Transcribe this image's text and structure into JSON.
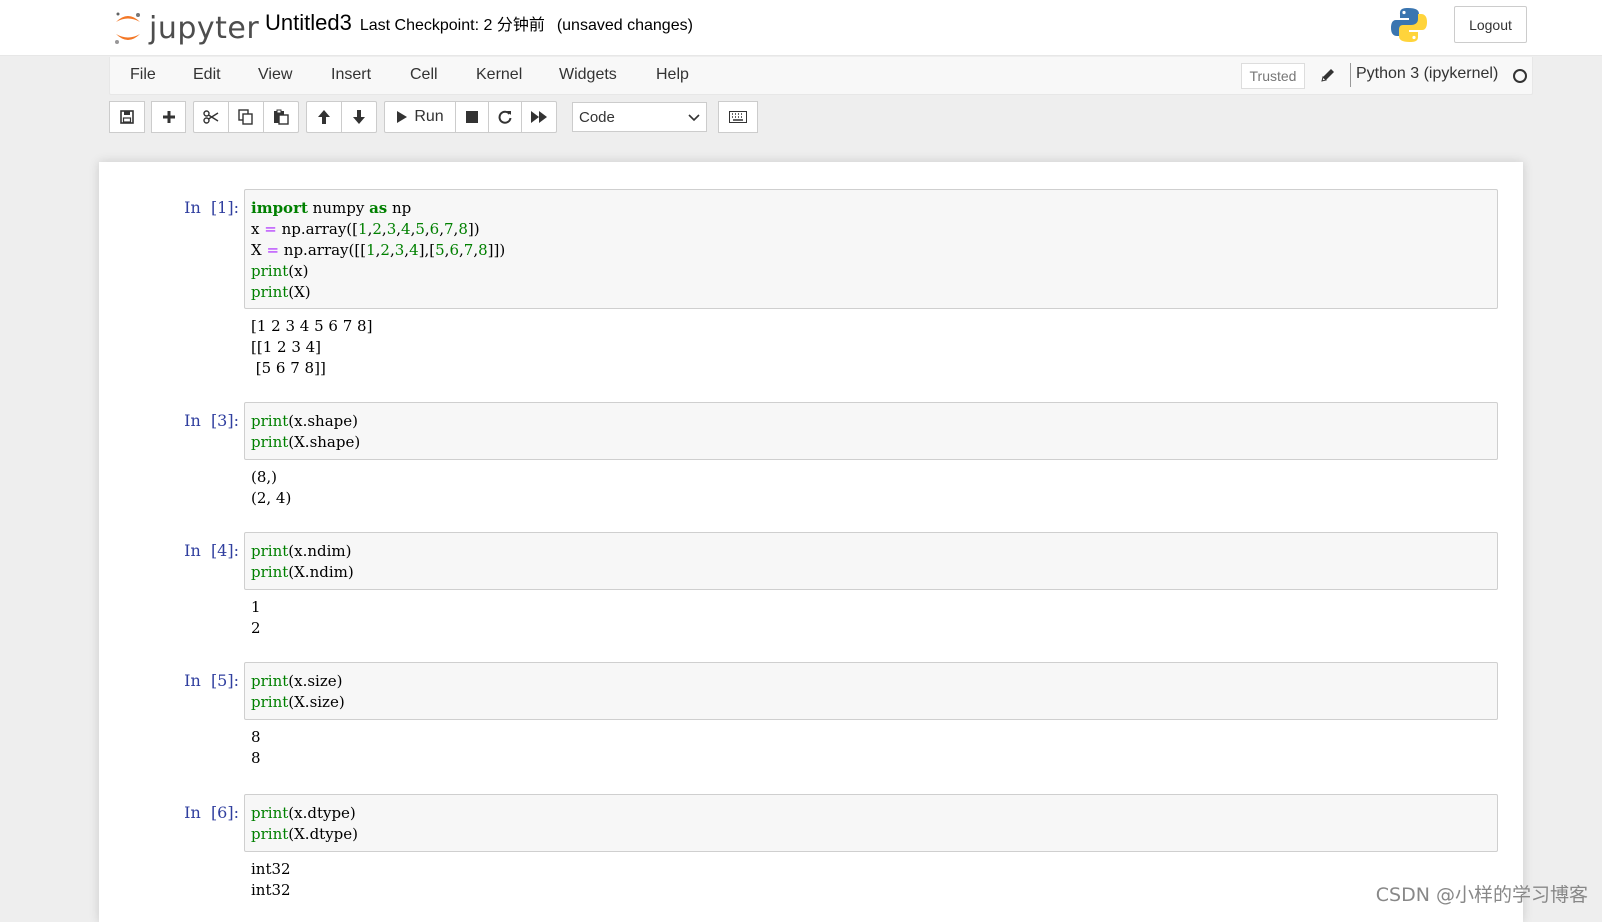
{
  "header": {
    "logo_text": "jupyter",
    "notebook_name": "Untitled3",
    "checkpoint": "Last Checkpoint: 2 分钟前",
    "autosave": "(unsaved changes)",
    "logout_label": "Logout"
  },
  "menubar": {
    "items": [
      "File",
      "Edit",
      "View",
      "Insert",
      "Cell",
      "Kernel",
      "Widgets",
      "Help"
    ],
    "trusted_label": "Trusted",
    "kernel_name": "Python 3 (ipykernel)"
  },
  "toolbar": {
    "buttons": [
      "save-icon",
      "plus-icon",
      "cut-icon",
      "copy-icon",
      "paste-icon",
      "arrow-up-icon",
      "arrow-down-icon",
      "run-icon",
      "stop-icon",
      "restart-icon",
      "fast-forward-icon",
      "keyboard-icon"
    ],
    "run_label": "Run",
    "cell_type": "Code"
  },
  "cells": [
    {
      "prompt": "In  [1]:",
      "input": [
        "import numpy as np",
        "x = np.array([1,2,3,4,5,6,7,8])",
        "X = np.array([[1,2,3,4],[5,6,7,8]])",
        "print(x)",
        "print(X)"
      ],
      "output": [
        "[1 2 3 4 5 6 7 8]",
        "[[1 2 3 4]",
        " [5 6 7 8]]"
      ]
    },
    {
      "prompt": "In  [3]:",
      "input": [
        "print(x.shape)",
        "print(X.shape)"
      ],
      "output": [
        "(8,)",
        "(2, 4)"
      ]
    },
    {
      "prompt": "In  [4]:",
      "input": [
        "print(x.ndim)",
        "print(X.ndim)"
      ],
      "output": [
        "1",
        "2"
      ]
    },
    {
      "prompt": "In  [5]:",
      "input": [
        "print(x.size)",
        "print(X.size)"
      ],
      "output": [
        "8",
        "8"
      ]
    },
    {
      "prompt": "In  [6]:",
      "input": [
        "print(x.dtype)",
        "print(X.dtype)"
      ],
      "output": [
        "int32",
        "int32"
      ]
    }
  ],
  "watermark": "CSDN @小样的学习博客"
}
